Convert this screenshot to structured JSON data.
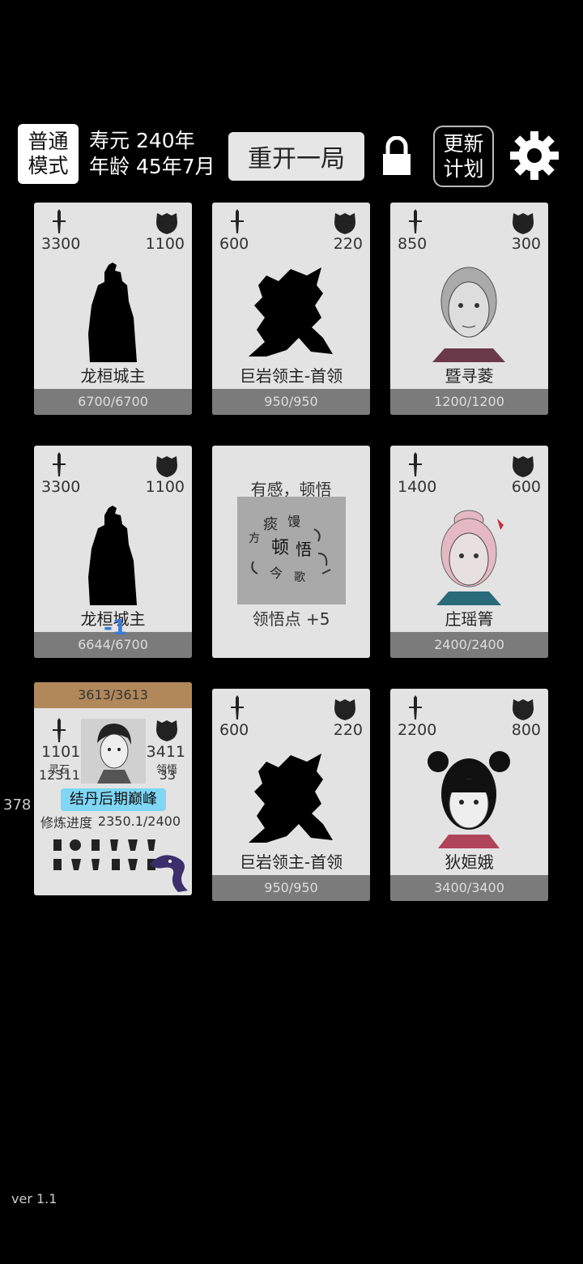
{
  "header": {
    "mode_line1": "普通",
    "mode_line2": "模式",
    "lifespan": "寿元 240年",
    "age": "年龄 45年7月",
    "restart": "重开一局",
    "plan_line1": "更新",
    "plan_line2": "计划"
  },
  "cards": [
    {
      "atk": "3300",
      "def": "1100",
      "name": "龙桓城主",
      "hp": "6700/6700"
    },
    {
      "atk": "600",
      "def": "220",
      "name": "巨岩领主-首领",
      "hp": "950/950"
    },
    {
      "atk": "850",
      "def": "300",
      "name": "暨寻菱",
      "hp": "1200/1200"
    },
    {
      "atk": "3300",
      "def": "1100",
      "name": "龙桓城主",
      "hp": "6644/6700"
    },
    {
      "atk": "1400",
      "def": "600",
      "name": "庄瑶箐",
      "hp": "2400/2400"
    },
    {
      "atk": "600",
      "def": "220",
      "name": "巨岩领主-首领",
      "hp": "950/950"
    },
    {
      "atk": "2200",
      "def": "800",
      "name": "狄姮娥",
      "hp": "3400/3400"
    }
  ],
  "event": {
    "title": "有感，顿悟",
    "reward": "领悟点  +5",
    "art_text": [
      "痰",
      "馒",
      "顿",
      "悟",
      "今",
      "歌",
      "方"
    ]
  },
  "damage_float": "-1",
  "player": {
    "hp": "3613/3613",
    "atk": "1101",
    "def": "3411",
    "label_left": "灵石",
    "label_right": "领悟",
    "value_left": "12311",
    "value_right": "33",
    "realm": "结丹后期巅峰",
    "progress_label": "修炼进度",
    "progress_value": "2350.1/2400"
  },
  "side_number": "378",
  "version": "ver 1.1"
}
